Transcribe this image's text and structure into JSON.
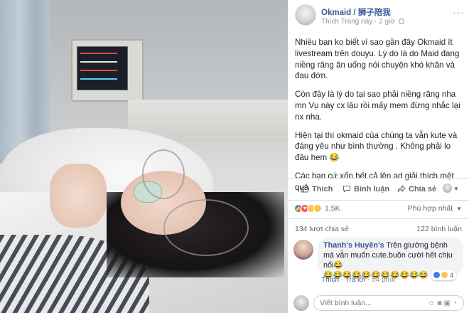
{
  "post": {
    "page_name": "Okmaid / 狮子陪我",
    "like_page": "Thích Trang này",
    "separator": "·",
    "time": "2 giờ",
    "more": "···",
    "paragraphs": [
      "Nhiều bạn ko biết vì sao gần đây Okmaid ít livestream trên douyu. Lý do là do Maid đang niềng răng ăn uống nói chuyện khó khăn và đau đớn.",
      "Còn đây là lý do tại sao phải niềng răng nha mn Vụ này cx lâu rồi mấy mem đừng nhắc lại nx nha.",
      "Hiện tại thì okmaid của chúng ta vẫn kute và đáng yêu như bình thường . Không phải lo đâu hem 😂",
      "Các bạn cứ xốn hết cả lên ad giải thích mệt quá"
    ]
  },
  "actions": {
    "like": "Thích",
    "comment": "Bình luận",
    "share": "Chia sẻ"
  },
  "stats": {
    "reaction_count": "1,5K",
    "sort_label": "Phù hợp nhất",
    "shares": "134 lượt chia sẻ",
    "comments": "122 bình luận"
  },
  "comment": {
    "author": "Thanh's Huyền's",
    "text": "Trên giường bệnh mà vẫn muốn cute.buồn cười hết chịu nổi😂",
    "emoji_line": "😂😂😂😂😂😂😂😂😂😂😂",
    "like": "Thích",
    "reply": "Trả lời",
    "time": "54 phút",
    "reaction_count": "4"
  },
  "composer": {
    "placeholder": "Viết bình luận..."
  },
  "colors": {
    "link": "#365899",
    "muted": "#90949c",
    "like_blue": "#4a76e8",
    "love_red": "#f25268",
    "haha_yellow": "#f7c84a"
  }
}
